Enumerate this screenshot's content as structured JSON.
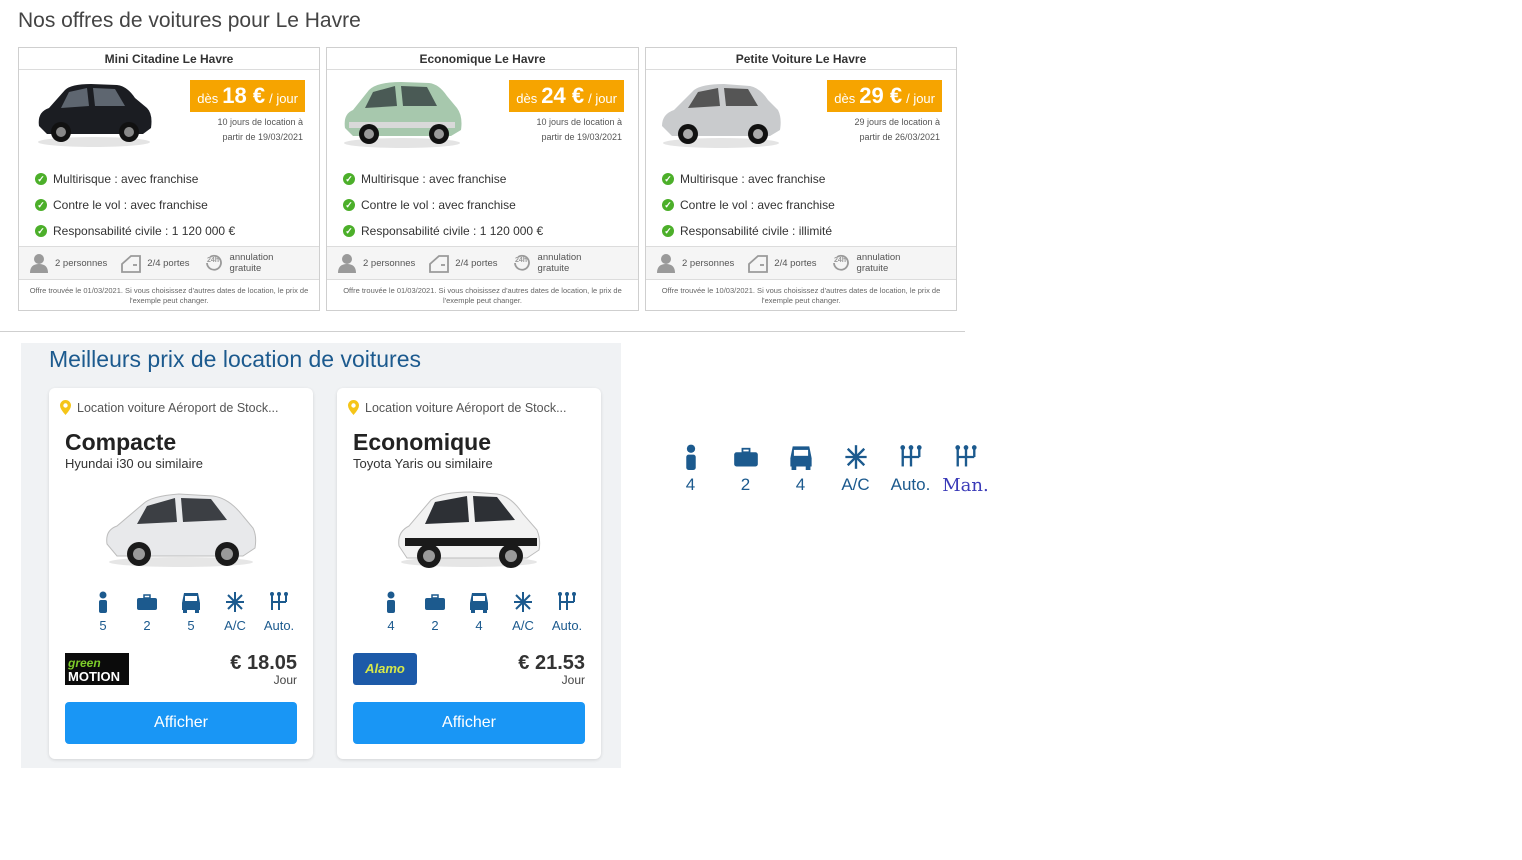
{
  "page_title": "Nos offres de voitures pour Le Havre",
  "offers": [
    {
      "title": "Mini Citadine Le Havre",
      "price_prefix": "dès",
      "price": "18 €",
      "price_unit": "/ jour",
      "note_line1": "10 jours de location à",
      "note_line2": "partir de 19/03/2021",
      "features": [
        "Multirisque : avec franchise",
        "Contre le vol : avec franchise",
        "Responsabilité civile : 1 120 000 €"
      ],
      "persons": "2 personnes",
      "doors": "2/4 portes",
      "cancel_line1": "annulation",
      "cancel_line2": "gratuite",
      "disclaimer": "Offre trouvée le 01/03/2021. Si vous choisissez d'autres dates de location, le prix de l'exemple peut changer.",
      "car_color": "#1b1d22"
    },
    {
      "title": "Economique Le Havre",
      "price_prefix": "dès",
      "price": "24 €",
      "price_unit": "/ jour",
      "note_line1": "10 jours de location à",
      "note_line2": "partir de 19/03/2021",
      "features": [
        "Multirisque : avec franchise",
        "Contre le vol : avec franchise",
        "Responsabilité civile : 1 120 000 €"
      ],
      "persons": "2 personnes",
      "doors": "2/4 portes",
      "cancel_line1": "annulation",
      "cancel_line2": "gratuite",
      "disclaimer": "Offre trouvée le 01/03/2021. Si vous choisissez d'autres dates de location, le prix de l'exemple peut changer.",
      "car_color": "#a7c8ad"
    },
    {
      "title": "Petite Voiture Le Havre",
      "price_prefix": "dès",
      "price": "29 €",
      "price_unit": "/ jour",
      "note_line1": "29 jours de location à",
      "note_line2": "partir de 26/03/2021",
      "features": [
        "Multirisque : avec franchise",
        "Contre le vol : avec franchise",
        "Responsabilité civile : illimité"
      ],
      "persons": "2 personnes",
      "doors": "2/4 portes",
      "cancel_line1": "annulation",
      "cancel_line2": "gratuite",
      "disclaimer": "Offre trouvée le 10/03/2021. Si vous choisissez d'autres dates de location, le prix de l'exemple peut changer.",
      "car_color": "#c9cbcd"
    }
  ],
  "best": {
    "title": "Meilleurs prix de location de voitures",
    "cards": [
      {
        "location": "Location voiture Aéroport de Stock...",
        "category": "Compacte",
        "model": "Hyundai i30 ou similaire",
        "specs": {
          "persons": "5",
          "bags": "2",
          "doors": "5",
          "ac": "A/C",
          "gear": "Auto."
        },
        "vendor": "green motion",
        "price": "€ 18.05",
        "per": "Jour",
        "button": "Afficher"
      },
      {
        "location": "Location voiture Aéroport de Stock...",
        "category": "Economique",
        "model": "Toyota Yaris ou similaire",
        "specs": {
          "persons": "4",
          "bags": "2",
          "doors": "4",
          "ac": "A/C",
          "gear": "Auto."
        },
        "vendor": "Alamo",
        "price": "€ 21.53",
        "per": "Jour",
        "button": "Afficher"
      }
    ]
  },
  "extra_specs": {
    "persons": "4",
    "bags": "2",
    "doors": "4",
    "ac": "A/C",
    "auto": "Auto.",
    "manual": "Man."
  },
  "colors": {
    "orange": "#f6a400",
    "green_check": "#4caf2a",
    "blue_button": "#1996f5",
    "title_blue": "#1c5a8e"
  }
}
